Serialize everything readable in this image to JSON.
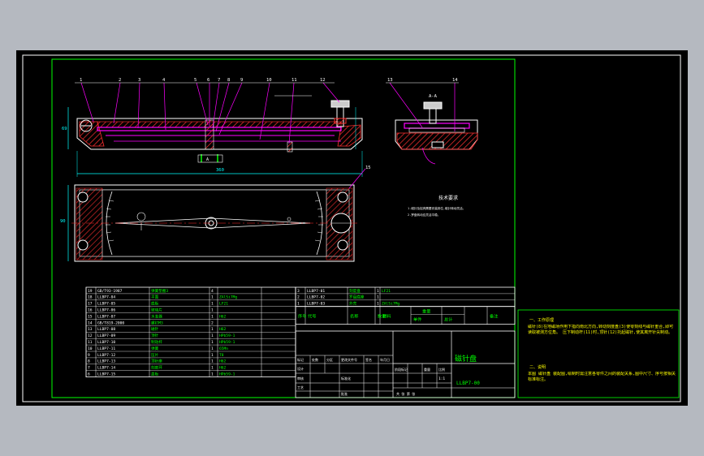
{
  "colors": {
    "background": "#b5b9c0",
    "viewport": "#000000",
    "frame": "#ffffff",
    "border": "#00ff00",
    "parts": "#ffffff",
    "magenta": "#ff00ff",
    "dimension": "#00ffff",
    "hatch": "#ff2a2a",
    "text_white": "#ffffff",
    "text_green": "#00ff00",
    "text_yellow": "#ffff00"
  },
  "balloons_front": [
    "1",
    "2",
    "3",
    "4",
    "5",
    "6",
    "7",
    "8",
    "9",
    "10",
    "11",
    "12"
  ],
  "balloons_side": [
    "13",
    "14"
  ],
  "balloon_plan": "15",
  "dim": {
    "length": "360",
    "height": "69",
    "width_plan": "90",
    "section_left": "A",
    "section_right": "A",
    "view_label": "A-A"
  },
  "notes_title": "技术要求",
  "notes_lines": [
    "1.磁针及铝壳需要安装到位,磁针转动灵活。",
    "2.罗盘转动应灵活平稳。"
  ],
  "bom_rows": [
    {
      "no": "19",
      "code": "GB/T93-1987",
      "name": "弹簧垫圈3",
      "qty": "4",
      "mat": "",
      "note": ""
    },
    {
      "no": "18",
      "code": "LLBP7-04",
      "name": "平面",
      "qty": "1",
      "mat": "ZAlSi7Mg",
      "note": ""
    },
    {
      "no": "17",
      "code": "LLBP7-05",
      "name": "底板",
      "qty": "1",
      "mat": "LF21",
      "note": ""
    },
    {
      "no": "16",
      "code": "LLBP7-06",
      "name": "玻璃片",
      "qty": "1",
      "mat": "",
      "note": ""
    },
    {
      "no": "15",
      "code": "LLBP7-07",
      "name": "水准器",
      "qty": "1",
      "mat": "H62",
      "note": ""
    },
    {
      "no": "14",
      "code": "GB/T819-2000",
      "name": "螺钉M3",
      "qty": "2",
      "mat": "",
      "note": ""
    },
    {
      "no": "13",
      "code": "LLBP7-08",
      "name": "磁针",
      "qty": "1",
      "mat": "H62",
      "note": ""
    },
    {
      "no": "12",
      "code": "LLBP7-09",
      "name": "顶针",
      "qty": "1",
      "mat": "HPb59-1",
      "note": ""
    },
    {
      "no": "11",
      "code": "LLBP7-10",
      "name": "制动杆",
      "qty": "1",
      "mat": "HPb59-1",
      "note": ""
    },
    {
      "no": "10",
      "code": "LLBP7-11",
      "name": "弹簧",
      "qty": "1",
      "mat": "65Mn",
      "note": ""
    },
    {
      "no": "9",
      "code": "LLBP7-12",
      "name": "压片",
      "qty": "1",
      "mat": "T8",
      "note": ""
    },
    {
      "no": "8",
      "code": "LLBP7-13",
      "name": "顶针座",
      "qty": "1",
      "mat": "H62",
      "note": ""
    },
    {
      "no": "7",
      "code": "LLBP7-14",
      "name": "刻度环",
      "qty": "1",
      "mat": "H62",
      "note": ""
    },
    {
      "no": "6",
      "code": "LLBP7-15",
      "name": "盖板",
      "qty": "1",
      "mat": "HPb59-1",
      "note": ""
    }
  ],
  "bom_rows_right": [
    {
      "no": "3",
      "code": "LLBP7-01",
      "name": "刻度盘",
      "qty": "1",
      "mat": "LF21",
      "note": ""
    },
    {
      "no": "2",
      "code": "LLBP7-02",
      "name": "罗盘底座",
      "qty": "1",
      "mat": "",
      "note": ""
    },
    {
      "no": "1",
      "code": "LLBP7-03",
      "name": "外壳",
      "qty": "1",
      "mat": "ZAlSi7Mg",
      "note": ""
    }
  ],
  "bom_header": [
    "序号",
    "代号",
    "名称",
    "数量",
    "材料",
    "单件",
    "总计",
    "备注"
  ],
  "bom_header_sub": "重量",
  "title_block": {
    "title": "磁针盘",
    "code": "LLBP7-00",
    "scale": "1:1",
    "headers": [
      "阶段标记",
      "重量",
      "比例"
    ],
    "rows": [
      "标记",
      "处数",
      "分区",
      "更改文件号",
      "签名",
      "年月日"
    ],
    "roles": [
      "设计",
      "审核",
      "工艺",
      "标准化",
      "批准"
    ],
    "sheet": "共 张 第 张"
  },
  "right_notes": {
    "title1": "一、工作原理",
    "body1": "磁针(8)在地磁场作用下指向南北方向,转动刻度盘(3)使零刻线与磁针重合,即可读取被测方位角。",
    "body1b": "压下制动杆(11)时,顶针(12)托起磁针,使其离开针尖制动。",
    "title2": "二、说明",
    "body2": "本图 磁针盘 装配图,绘制时需注意各零件之间的装配关系,图中尺寸、序号按相关标准标注。"
  }
}
